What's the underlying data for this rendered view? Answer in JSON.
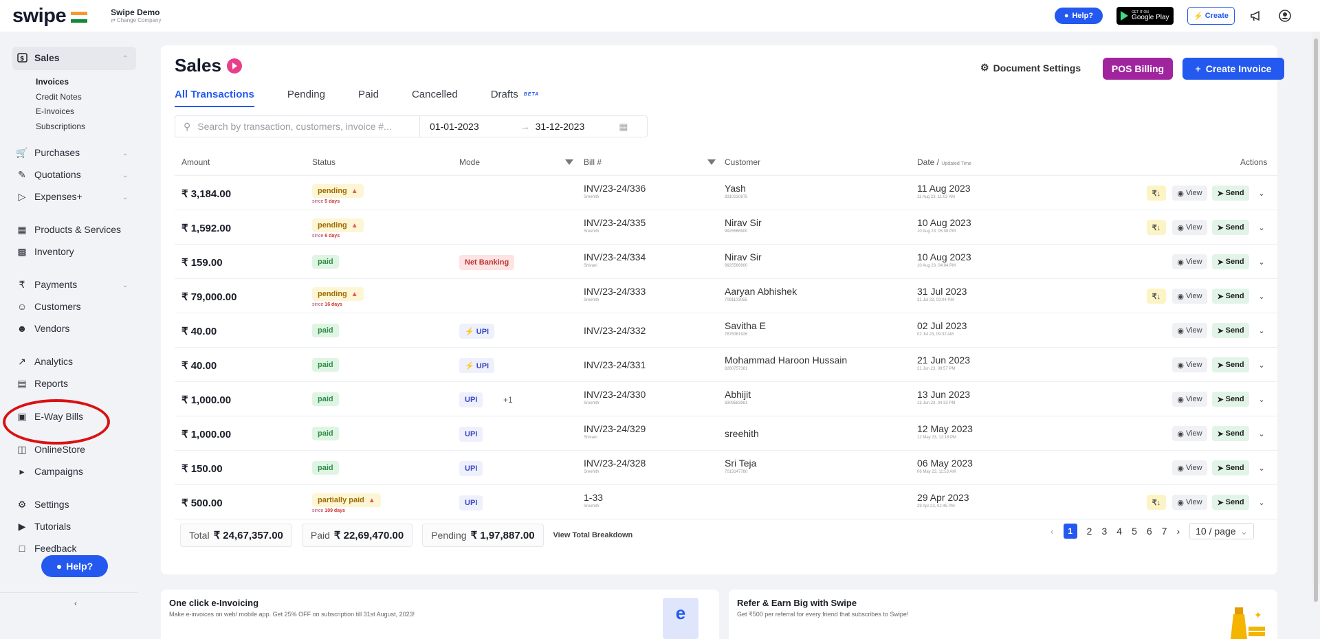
{
  "brand": {
    "logo": "swipe",
    "company_name": "Swipe Demo",
    "change_company": "⇄ Change Company"
  },
  "topbar": {
    "help": "Help?",
    "gplay_small": "GET IT ON",
    "gplay_big": "Google Play",
    "create": "Create"
  },
  "sidebar": {
    "sales": "Sales",
    "sub_items": [
      "Invoices",
      "Credit Notes",
      "E-Invoices",
      "Subscriptions"
    ],
    "items": [
      "Purchases",
      "Quotations",
      "Expenses+",
      "Products & Services",
      "Inventory",
      "Payments",
      "Customers",
      "Vendors",
      "Analytics",
      "Reports",
      "E-Way Bills",
      "OnlineStore",
      "Campaigns",
      "Settings",
      "Tutorials",
      "Feedback"
    ],
    "help": "Help?"
  },
  "header": {
    "title": "Sales",
    "doc_settings": "Document Settings",
    "pos_billing": "POS Billing",
    "create_invoice": "Create Invoice"
  },
  "tabs": [
    "All Transactions",
    "Pending",
    "Paid",
    "Cancelled",
    "Drafts"
  ],
  "beta": "BETA",
  "search": {
    "placeholder": "Search by transaction, customers, invoice #...",
    "from": "01-01-2023",
    "to": "31-12-2023"
  },
  "columns": {
    "amount": "Amount",
    "status": "Status",
    "mode": "Mode",
    "bill": "Bill #",
    "customer": "Customer",
    "date": "Date /",
    "date_sub": "Updated Time",
    "actions": "Actions"
  },
  "rows": [
    {
      "amount": "₹ 3,184.00",
      "status": "pending",
      "since": "since",
      "since_days": "5 days",
      "mode": "",
      "bill": "INV/23-24/336",
      "bill_sub": "Sreehith",
      "customer": "Yash",
      "cust_sub": "8310230875",
      "date": "11 Aug 2023",
      "date_sub": "11 Aug 23, 11:02 AM",
      "rupee": true
    },
    {
      "amount": "₹ 1,592.00",
      "status": "pending",
      "since": "since",
      "since_days": "6 days",
      "mode": "",
      "bill": "INV/23-24/335",
      "bill_sub": "Sreehith",
      "customer": "Nirav Sir",
      "cust_sub": "9925566900",
      "date": "10 Aug 2023",
      "date_sub": "10 Aug 23, 05:08 PM",
      "rupee": true
    },
    {
      "amount": "₹ 159.00",
      "status": "paid",
      "mode": "Net Banking",
      "bill": "INV/23-24/334",
      "bill_sub": "Shivani",
      "customer": "Nirav Sir",
      "cust_sub": "9925566900",
      "date": "10 Aug 2023",
      "date_sub": "10 Aug 23, 04:04 PM",
      "rupee": false
    },
    {
      "amount": "₹ 79,000.00",
      "status": "pending",
      "since": "since",
      "since_days": "16 days",
      "mode": "",
      "bill": "INV/23-24/333",
      "bill_sub": "Sreehith",
      "customer": "Aaryan Abhishek",
      "cust_sub": "7091103055",
      "date": "31 Jul 2023",
      "date_sub": "31 Jul 23, 03:04 PM",
      "rupee": true
    },
    {
      "amount": "₹ 40.00",
      "status": "paid",
      "mode": "⚡ UPI",
      "bill": "INV/23-24/332",
      "bill_sub": "",
      "customer": "Savitha E",
      "cust_sub": "7676361926",
      "date": "02 Jul 2023",
      "date_sub": "02 Jul 23, 09:32 AM",
      "rupee": false
    },
    {
      "amount": "₹ 40.00",
      "status": "paid",
      "mode": "⚡ UPI",
      "bill": "INV/23-24/331",
      "bill_sub": "",
      "customer": "Mohammad Haroon Hussain",
      "cust_sub": "8280757381",
      "date": "21 Jun 2023",
      "date_sub": "21 Jun 23, 08:57 PM",
      "rupee": false
    },
    {
      "amount": "₹ 1,000.00",
      "status": "paid",
      "mode": "UPI",
      "plus": "+1",
      "bill": "INV/23-24/330",
      "bill_sub": "Sreehith",
      "customer": "Abhijit",
      "cust_sub": "8309583981",
      "date": "13 Jun 2023",
      "date_sub": "13 Jun 23, 04:33 PM",
      "rupee": false
    },
    {
      "amount": "₹ 1,000.00",
      "status": "paid",
      "mode": "UPI",
      "bill": "INV/23-24/329",
      "bill_sub": "Shivani",
      "customer": "sreehith",
      "cust_sub": "",
      "date": "12 May 2023",
      "date_sub": "12 May 23, 12:18 PM",
      "rupee": false
    },
    {
      "amount": "₹ 150.00",
      "status": "paid",
      "mode": "UPI",
      "bill": "INV/23-24/328",
      "bill_sub": "Sreehith",
      "customer": "Sri Teja",
      "cust_sub": "7013147780",
      "date": "06 May 2023",
      "date_sub": "06 May 23, 11:53 AM",
      "rupee": false
    },
    {
      "amount": "₹ 500.00",
      "status": "partially paid",
      "since": "since",
      "since_days": "109 days",
      "mode": "UPI",
      "bill": "1-33",
      "bill_sub": "Sreehith",
      "customer": "",
      "cust_sub": "",
      "date": "29 Apr 2023",
      "date_sub": "29 Apr 23, 02:45 PM",
      "rupee": true
    }
  ],
  "actions": {
    "rupee": "₹↓",
    "view": "View",
    "send": "Send"
  },
  "totals": {
    "total_label": "Total",
    "total": "₹ 24,67,357.00",
    "paid_label": "Paid",
    "paid": "₹ 22,69,470.00",
    "pending_label": "Pending",
    "pending": "₹ 1,97,887.00",
    "breakdown": "View Total Breakdown"
  },
  "pager": {
    "pages": [
      "1",
      "2",
      "3",
      "4",
      "5",
      "6",
      "7"
    ],
    "page_size": "10 / page"
  },
  "promos": [
    {
      "title": "One click e-Invoicing",
      "desc": "Make e-invoices on web/ mobile app. Get 25% OFF on subscription till 31st August, 2023!"
    },
    {
      "title": "Refer & Earn Big with Swipe",
      "desc": "Get ₹500 per referral for every friend that subscribes to Swipe!"
    }
  ],
  "colors": {
    "accent": "#2459f0",
    "pos": "#a1249f",
    "highlight": "#d81212"
  }
}
